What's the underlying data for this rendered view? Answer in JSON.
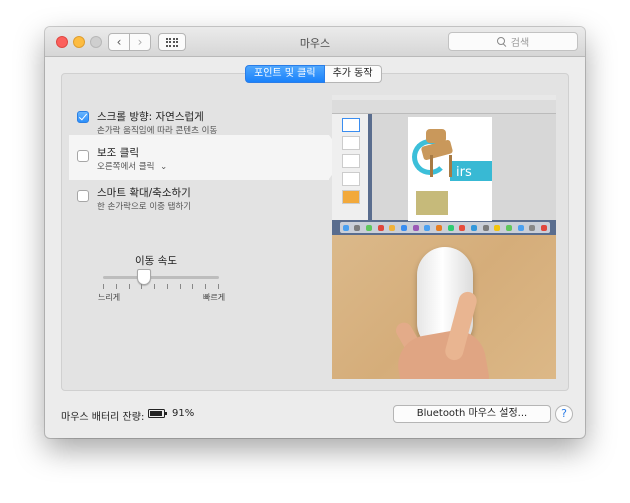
{
  "window": {
    "title": "마우스",
    "search_placeholder": "검색",
    "nav_back_icon": "chevron-left-icon",
    "nav_forward_icon": "chevron-right-icon",
    "show_all_icon": "grid-icon"
  },
  "tabs": [
    {
      "label": "포인트 및 클릭",
      "active": true
    },
    {
      "label": "추가 동작",
      "active": false
    }
  ],
  "options": [
    {
      "title": "스크롤 방향: 자연스럽게",
      "subtitle": "손가락 움직임에 따라 콘텐츠 이동",
      "checked": true
    },
    {
      "title": "보조 클릭",
      "subtitle": "오른쪽에서 클릭",
      "checked": false
    },
    {
      "title": "스마트 확대/축소하기",
      "subtitle": "한 손가락으로 이중 탭하기",
      "checked": false
    }
  ],
  "tracking_speed": {
    "title": "이동 속도",
    "low_label": "느리게",
    "high_label": "빠르게",
    "value_fraction": 0.35
  },
  "preview": {
    "doc_text": "irs"
  },
  "footer": {
    "battery_label": "마우스 배터리 잔량:",
    "battery_percent": "91%",
    "battery_level": 0.91,
    "bluetooth_button": "Bluetooth 마우스 설정...",
    "help_label": "?"
  },
  "colors": {
    "accent": "#1a82fb",
    "close": "#fc605c",
    "minimize": "#fdbc40",
    "zoom_disabled": "#cfcfcf"
  }
}
